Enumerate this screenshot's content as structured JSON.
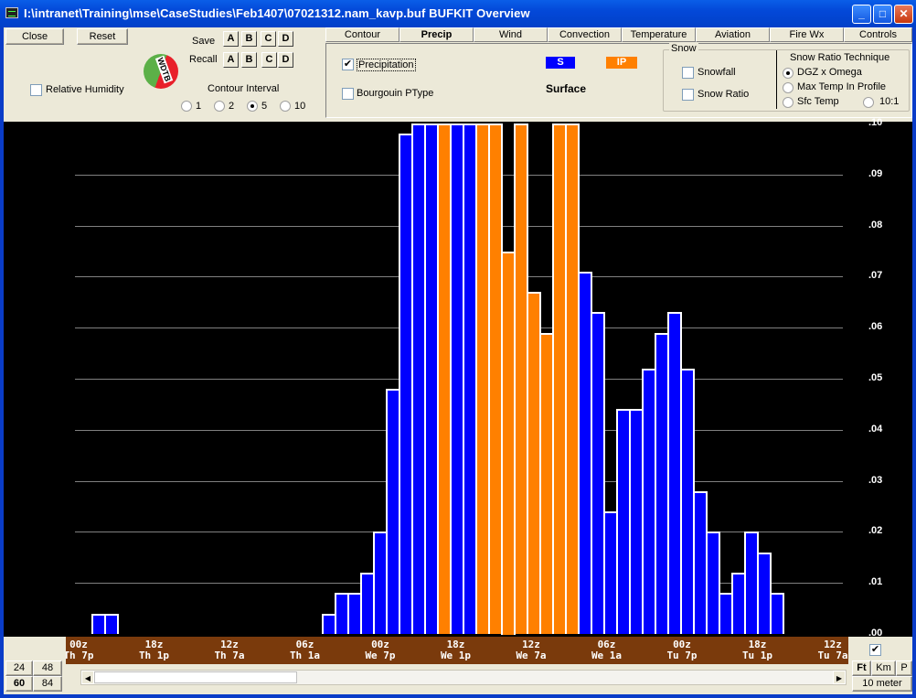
{
  "window": {
    "title": "I:\\intranet\\Training\\mse\\CaseStudies\\Feb1407\\07021312.nam_kavp.buf BUFKIT Overview",
    "minimize": "_",
    "maximize": "□",
    "close": "✕"
  },
  "toolbar": {
    "close_label": "Close",
    "reset_label": "Reset",
    "save_label": "Save",
    "recall_label": "Recall",
    "slots": [
      "A",
      "B",
      "C",
      "D"
    ],
    "relative_humidity_label": "Relative Humidity",
    "relative_humidity_checked": false,
    "contour_interval_label": "Contour Interval",
    "contour_intervals": [
      "1",
      "2",
      "5",
      "10"
    ],
    "contour_interval_selected": "5",
    "logo": "WDTB"
  },
  "tabs": [
    {
      "label": "Contour",
      "active": false
    },
    {
      "label": "Precip",
      "active": true
    },
    {
      "label": "Wind",
      "active": false
    },
    {
      "label": "Convection",
      "active": false
    },
    {
      "label": "Temperature",
      "active": false
    },
    {
      "label": "Aviation",
      "active": false
    },
    {
      "label": "Fire Wx",
      "active": false
    },
    {
      "label": "Controls",
      "active": false
    }
  ],
  "precip_panel": {
    "precipitation_label": "Precipitation",
    "precipitation_checked": true,
    "bourgouin_label": "Bourgouin PType",
    "bourgouin_checked": false,
    "legend": [
      {
        "label": "S",
        "color": "#0000ff"
      },
      {
        "label": "IP",
        "color": "#ff8000"
      }
    ],
    "surface_label": "Surface",
    "snow_group_label": "Snow",
    "snowfall_label": "Snowfall",
    "snowfall_checked": false,
    "snow_ratio_label": "Snow Ratio",
    "snow_ratio_checked": false,
    "technique_label": "Snow Ratio Technique",
    "techniques": [
      "DGZ x Omega",
      "Max Temp In Profile",
      "Sfc Temp",
      "10:1"
    ],
    "technique_selected": "DGZ x Omega"
  },
  "chart_data": {
    "type": "bar",
    "title": "Surface Precipitation",
    "ylabel": "Precipitation",
    "ylim": [
      0,
      0.1
    ],
    "yticks": [
      ".10",
      ".09",
      ".08",
      ".07",
      ".06",
      ".05",
      ".04",
      ".03",
      ".02",
      ".01",
      ".00"
    ],
    "grid": true,
    "legend": [
      "S",
      "IP"
    ],
    "colors": {
      "S": "#0000ff",
      "IP": "#ff8000"
    },
    "x_tick_labels": [
      {
        "z": "00z",
        "local": "Th 7p"
      },
      {
        "z": "18z",
        "local": "Th 1p"
      },
      {
        "z": "12z",
        "local": "Th 7a"
      },
      {
        "z": "06z",
        "local": "Th 1a"
      },
      {
        "z": "00z",
        "local": "We 7p"
      },
      {
        "z": "18z",
        "local": "We 1p"
      },
      {
        "z": "12z",
        "local": "We 7a"
      },
      {
        "z": "06z",
        "local": "We 1a"
      },
      {
        "z": "00z",
        "local": "Tu 7p"
      },
      {
        "z": "18z",
        "local": "Tu 1p"
      },
      {
        "z": "12z",
        "local": "Tu 7a"
      }
    ],
    "hours_from_left": [
      0,
      1,
      2,
      3,
      4,
      5,
      6,
      7,
      8,
      9,
      10,
      11,
      12,
      13,
      14,
      15,
      16,
      17,
      18,
      19,
      20,
      21,
      22,
      23,
      24,
      25,
      26,
      27,
      28,
      29,
      30,
      31,
      32,
      33,
      34,
      35,
      36,
      37,
      38,
      39,
      40,
      41,
      42,
      43,
      44,
      45,
      46,
      47,
      48,
      49,
      50,
      51,
      52,
      53,
      54,
      55,
      56,
      57,
      58,
      59
    ],
    "values": [
      0.004,
      0.004,
      0,
      0,
      0,
      0,
      0,
      0,
      0,
      0,
      0,
      0,
      0,
      0,
      0,
      0,
      0,
      0,
      0.004,
      0.008,
      0.008,
      0.012,
      0.02,
      0.048,
      0.098,
      0.1,
      0.1,
      0.1,
      0.1,
      0.1,
      0.1,
      0.1,
      0.075,
      0.1,
      0.067,
      0.059,
      0.1,
      0.1,
      0.071,
      0.063,
      0.024,
      0.044,
      0.044,
      0.052,
      0.059,
      0.063,
      0.052,
      0.028,
      0.02,
      0.008,
      0.012,
      0.02,
      0.016,
      0.008,
      0,
      0,
      0,
      0,
      0,
      0
    ],
    "types": [
      "S",
      "S",
      "",
      "",
      "",
      "",
      "",
      "",
      "",
      "",
      "",
      "",
      "",
      "",
      "",
      "",
      "",
      "",
      "S",
      "S",
      "S",
      "S",
      "S",
      "S",
      "S",
      "S",
      "S",
      "IP",
      "S",
      "S",
      "IP",
      "IP",
      "IP",
      "IP",
      "IP",
      "IP",
      "IP",
      "IP",
      "S",
      "S",
      "S",
      "S",
      "S",
      "S",
      "S",
      "S",
      "S",
      "S",
      "S",
      "S",
      "S",
      "S",
      "S",
      "S",
      "",
      "",
      "",
      "",
      "",
      ""
    ]
  },
  "bottom": {
    "range_buttons": [
      "24",
      "48",
      "60",
      "84"
    ],
    "range_selected": "60",
    "units_checked": true,
    "unit_buttons": [
      "Ft",
      "Km",
      "P"
    ],
    "unit_selected": "Ft",
    "level_label": "10 meter",
    "scroll_position_percent": 0
  }
}
